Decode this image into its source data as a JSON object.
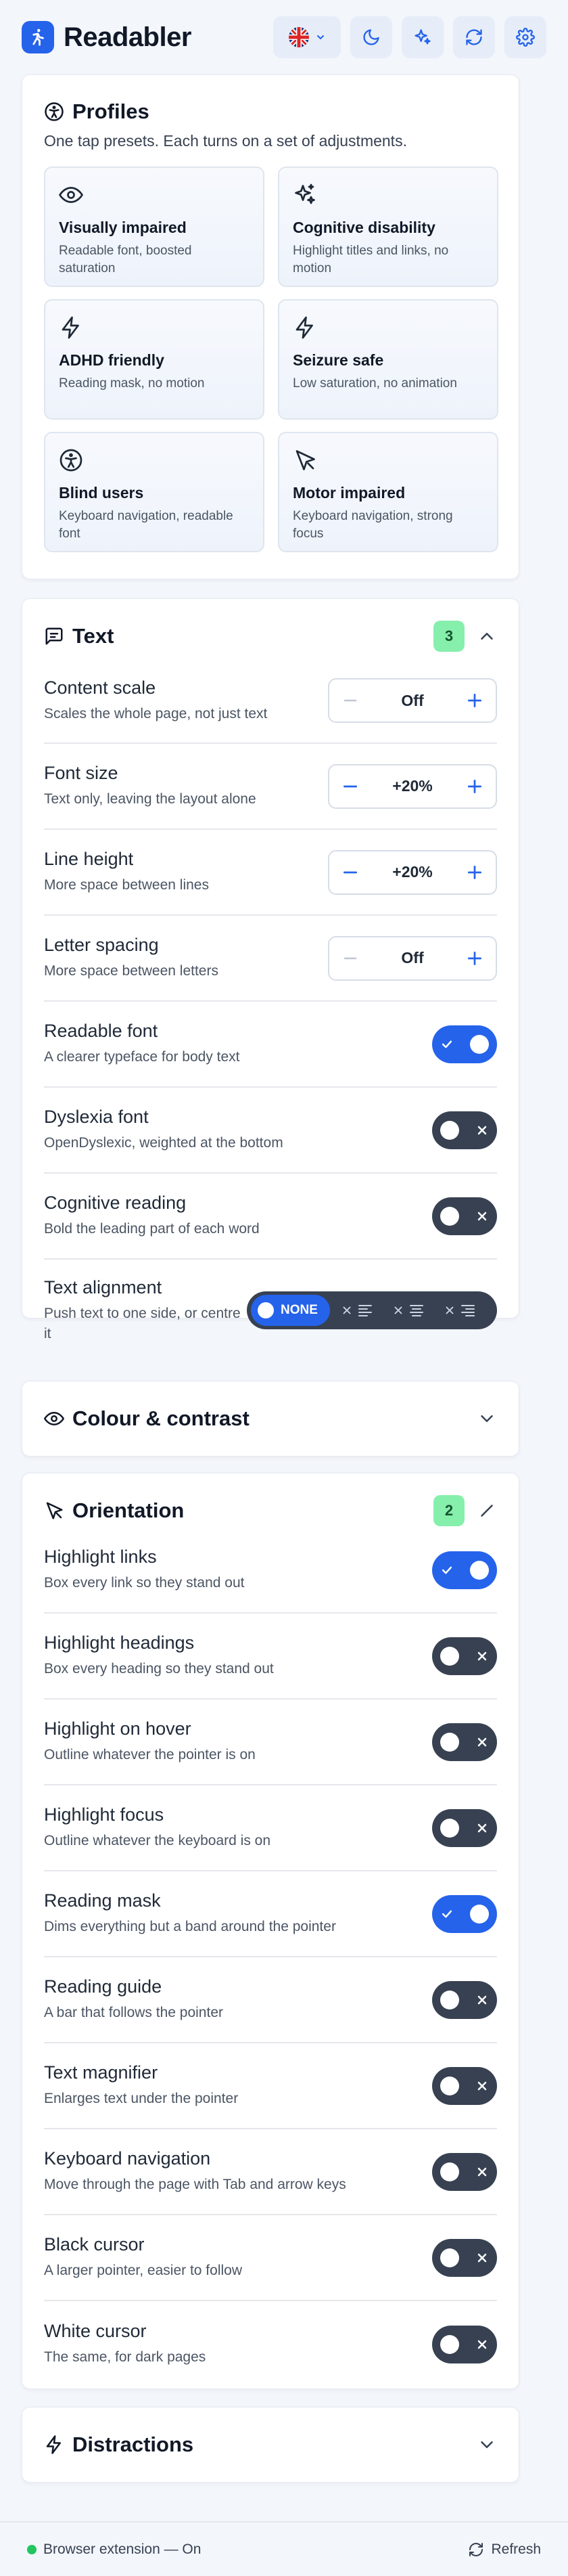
{
  "app": {
    "name": "Readabler"
  },
  "header": {
    "lang_flag": "UK flag"
  },
  "profiles": {
    "title": "Profiles",
    "subtitle": "One tap presets. Each turns on a set of adjustments.",
    "items": [
      {
        "icon": "eye-icon",
        "name": "Visually impaired",
        "desc": "Readable font, boosted saturation"
      },
      {
        "icon": "sparkles-icon",
        "name": "Cognitive disability",
        "desc": "Highlight titles and links, no motion"
      },
      {
        "icon": "bolt-icon",
        "name": "ADHD friendly",
        "desc": "Reading mask, no motion"
      },
      {
        "icon": "bolt-icon",
        "name": "Seizure safe",
        "desc": "Low saturation, no animation"
      },
      {
        "icon": "accessibility-icon",
        "name": "Blind users",
        "desc": "Keyboard navigation, readable font"
      },
      {
        "icon": "cursor-icon",
        "name": "Motor impaired",
        "desc": "Keyboard navigation, strong focus"
      }
    ]
  },
  "text_section": {
    "title": "Text",
    "count": "3",
    "content_scale": {
      "label": "Content scale",
      "desc": "Scales the whole page, not just text",
      "value": "Off"
    },
    "font_size": {
      "label": "Font size",
      "desc": "Text only, leaving the layout alone",
      "value": "+20%"
    },
    "line_height": {
      "label": "Line height",
      "desc": "More space between lines",
      "value": "+20%"
    },
    "letter_spacing": {
      "label": "Letter spacing",
      "desc": "More space between letters",
      "value": "Off"
    },
    "readable_font": {
      "label": "Readable font",
      "desc": "A clearer typeface for body text",
      "on": true
    },
    "dyslexia_font": {
      "label": "Dyslexia font",
      "desc": "OpenDyslexic, weighted at the bottom",
      "on": false
    },
    "cognitive_reading": {
      "label": "Cognitive reading",
      "desc": "Bold the leading part of each word",
      "on": false
    },
    "text_alignment": {
      "label": "Text alignment",
      "desc": "Push text to one side, or centre it",
      "selected": "NONE"
    }
  },
  "colour_section": {
    "title": "Colour & contrast"
  },
  "orientation_section": {
    "title": "Orientation",
    "count": "2",
    "items": [
      {
        "label": "Highlight links",
        "desc": "Box every link so they stand out",
        "on": true
      },
      {
        "label": "Highlight headings",
        "desc": "Box every heading so they stand out",
        "on": false
      },
      {
        "label": "Highlight on hover",
        "desc": "Outline whatever the pointer is on",
        "on": false
      },
      {
        "label": "Highlight focus",
        "desc": "Outline whatever the keyboard is on",
        "on": false
      },
      {
        "label": "Reading mask",
        "desc": "Dims everything but a band around the pointer",
        "on": true
      },
      {
        "label": "Reading guide",
        "desc": "A bar that follows the pointer",
        "on": false
      },
      {
        "label": "Text magnifier",
        "desc": "Enlarges text under the pointer",
        "on": false
      },
      {
        "label": "Keyboard navigation",
        "desc": "Move through the page with Tab and arrow keys",
        "on": false
      },
      {
        "label": "Black cursor",
        "desc": "A larger pointer, easier to follow",
        "on": false
      },
      {
        "label": "White cursor",
        "desc": "The same, for dark pages",
        "on": false
      }
    ]
  },
  "distractions_section": {
    "title": "Distractions"
  },
  "footer": {
    "status": "Browser extension — On",
    "refresh": "Refresh"
  },
  "colors": {
    "accent": "#2563eb",
    "toggle_off": "#374151",
    "badge": "#86efac",
    "status_dot": "#22c55e"
  }
}
